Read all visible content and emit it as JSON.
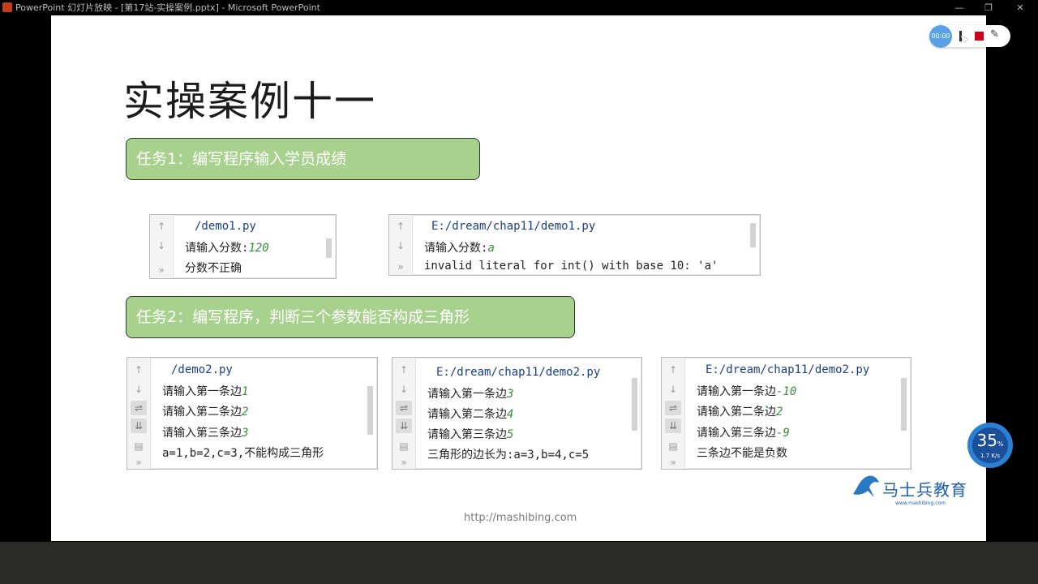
{
  "window": {
    "title": "PowerPoint 幻灯片放映 - [第17站-实操案例.pptx] - Microsoft PowerPoint"
  },
  "recorder": {
    "timer": "00:00"
  },
  "slide": {
    "title": "实操案例十一",
    "task1": "任务1：编写程序输入学员成绩",
    "task2": "任务2：编写程序，判断三个参数能否构成三角形",
    "footer_url": "http://mashibing.com",
    "logo_text": "马士兵教育",
    "logo_sub": "www.mashibing.com"
  },
  "consoles": {
    "c1": {
      "path": "/demo1.py",
      "line1_prompt": "请输入分数:",
      "line1_input": "120",
      "line2": "分数不正确"
    },
    "c2": {
      "path": "E:/dream/chap11/demo1.py",
      "line1_prompt": "请输入分数:",
      "line1_input": "a",
      "line2": "invalid literal for int() with base 10: 'a'"
    },
    "c3": {
      "path": "/demo2.py",
      "l1_prompt": "请输入第一条边",
      "l1_input": "1",
      "l2_prompt": "请输入第二条边",
      "l2_input": "2",
      "l3_prompt": "请输入第三条边",
      "l3_input": "3",
      "result": "a=1,b=2,c=3,不能构成三角形"
    },
    "c4": {
      "path": "E:/dream/chap11/demo2.py",
      "l1_prompt": "请输入第一条边",
      "l1_input": "3",
      "l2_prompt": "请输入第二条边",
      "l2_input": "4",
      "l3_prompt": "请输入第三条边",
      "l3_input": "5",
      "result": "三角形的边长为:a=3,b=4,c=5"
    },
    "c5": {
      "path": "E:/dream/chap11/demo2.py",
      "l1_prompt": "请输入第一条边",
      "l1_input": "-10",
      "l2_prompt": "请输入第二条边",
      "l2_input": "2",
      "l3_prompt": "请输入第三条边",
      "l3_input": "-9",
      "result": "三条边不能是负数"
    }
  },
  "speed_widget": {
    "percent": "35",
    "percent_sign": "%",
    "rate": "1.7 K/s"
  },
  "colors": {
    "task_fill": "#a9d18e",
    "path_text": "#1a3f8a",
    "input_text": "#3a8c3a"
  }
}
